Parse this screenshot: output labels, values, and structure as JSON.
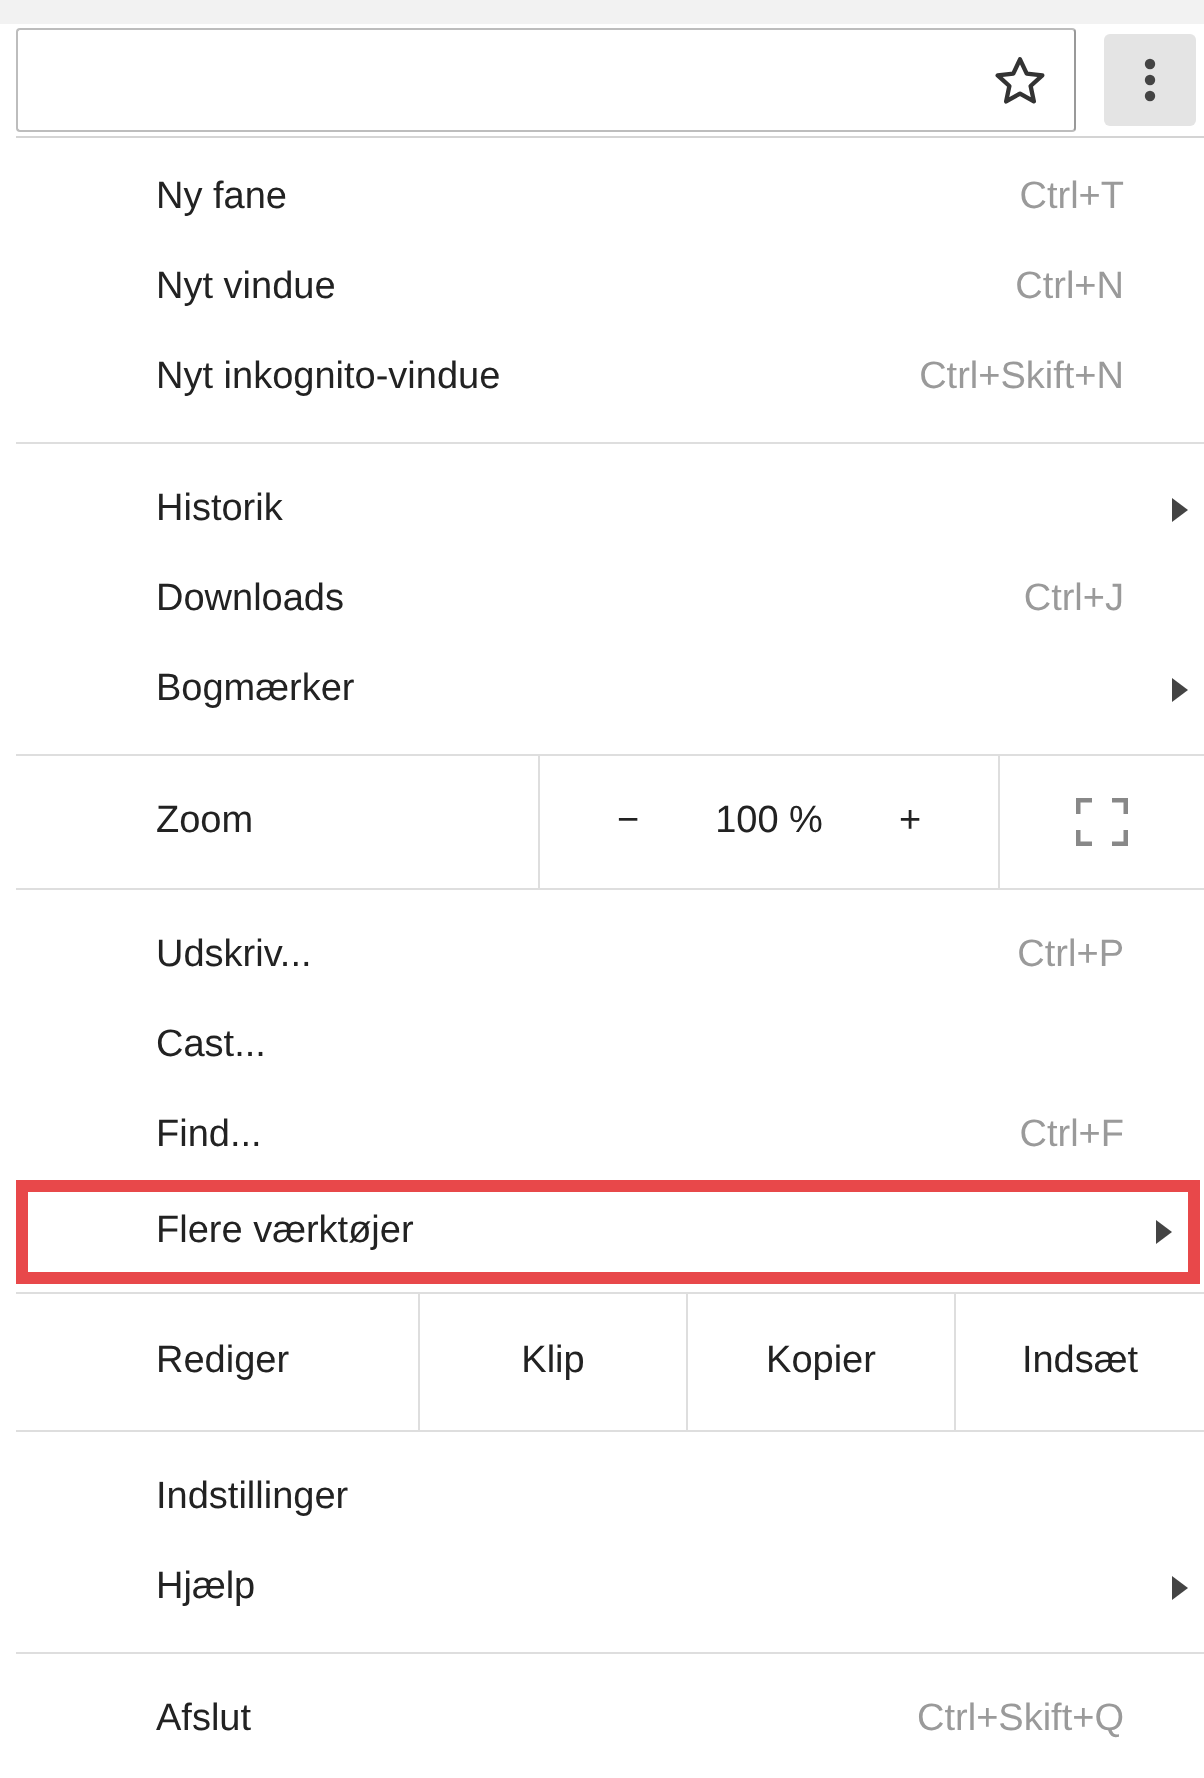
{
  "toolbar": {
    "bookmark_starred": false
  },
  "sections": [
    {
      "kind": "items",
      "items": [
        {
          "label": "Ny fane",
          "shortcut": "Ctrl+T",
          "submenu": false,
          "highlighted": false
        },
        {
          "label": "Nyt vindue",
          "shortcut": "Ctrl+N",
          "submenu": false,
          "highlighted": false
        },
        {
          "label": "Nyt inkognito-vindue",
          "shortcut": "Ctrl+Skift+N",
          "submenu": false,
          "highlighted": false
        }
      ]
    },
    {
      "kind": "items",
      "items": [
        {
          "label": "Historik",
          "submenu": true,
          "highlighted": false
        },
        {
          "label": "Downloads",
          "shortcut": "Ctrl+J",
          "submenu": false,
          "highlighted": false
        },
        {
          "label": "Bogmærker",
          "submenu": true,
          "highlighted": false
        }
      ]
    },
    {
      "kind": "zoom",
      "label": "Zoom",
      "minus": "−",
      "value": "100 %",
      "plus": "+"
    },
    {
      "kind": "items",
      "items": [
        {
          "label": "Udskriv...",
          "shortcut": "Ctrl+P",
          "submenu": false,
          "highlighted": false
        },
        {
          "label": "Cast...",
          "submenu": false,
          "highlighted": false
        },
        {
          "label": "Find...",
          "shortcut": "Ctrl+F",
          "submenu": false,
          "highlighted": false
        },
        {
          "label": "Flere værktøjer",
          "submenu": true,
          "highlighted": true
        }
      ]
    },
    {
      "kind": "edit",
      "label": "Rediger",
      "buttons": [
        "Klip",
        "Kopier",
        "Indsæt"
      ]
    },
    {
      "kind": "items",
      "items": [
        {
          "label": "Indstillinger",
          "submenu": false,
          "highlighted": false
        },
        {
          "label": "Hjælp",
          "submenu": true,
          "highlighted": false
        }
      ]
    },
    {
      "kind": "items",
      "items": [
        {
          "label": "Afslut",
          "shortcut": "Ctrl+Skift+Q",
          "submenu": false,
          "highlighted": false
        }
      ]
    }
  ]
}
